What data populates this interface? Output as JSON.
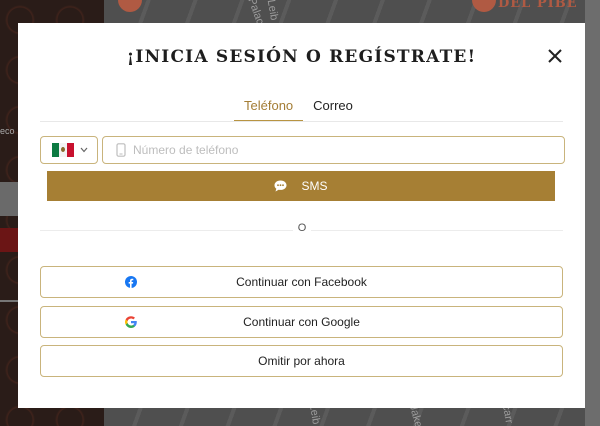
{
  "modal": {
    "title": "¡INICIA SESIÓN O REGÍSTRATE!",
    "tabs": [
      {
        "label": "Teléfono",
        "active": true
      },
      {
        "label": "Correo",
        "active": false
      }
    ],
    "phone": {
      "placeholder": "Número de teléfono",
      "value": ""
    },
    "country": {
      "flag": "mexico-flag-icon"
    },
    "sms_button": {
      "label": "SMS"
    },
    "divider_text": "O",
    "facebook_button": {
      "label": "Continuar con Facebook"
    },
    "google_button": {
      "label": "Continuar con Google"
    },
    "skip_button": {
      "label": "Omitir por ahora"
    }
  },
  "colors": {
    "accent": "#a67f34",
    "border": "#c9b47c",
    "active_tab_text": "#a47d35",
    "facebook_blue": "#1877f2"
  },
  "background": {
    "logo_text": "DEL PIBE",
    "street_labels": [
      "Leib",
      "Palace",
      "Leib",
      "Jake",
      "carr"
    ],
    "left_fragment": "eco"
  }
}
